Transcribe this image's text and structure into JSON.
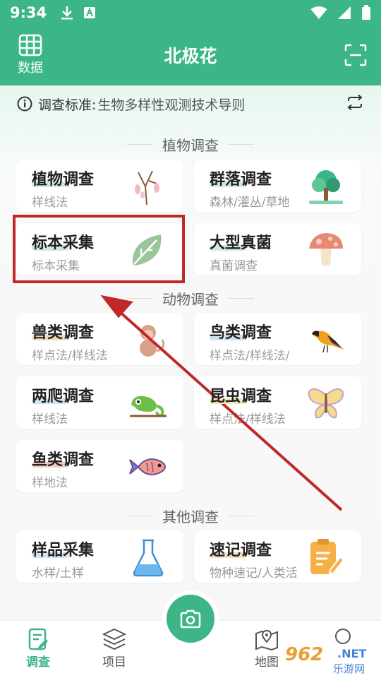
{
  "status_bar": {
    "time": "9:34"
  },
  "header": {
    "data_label": "数据",
    "title": "北极花"
  },
  "standard": {
    "label": "调查标准:",
    "value": "生物多样性观测技术导则"
  },
  "sections": {
    "plants": "植物调查",
    "animals": "动物调查",
    "other": "其他调查"
  },
  "cards": {
    "plant_survey": {
      "title": "植物调查",
      "subtitle": "样线法",
      "icon": "flower-branch-icon"
    },
    "community_survey": {
      "title": "群落调查",
      "subtitle": "森林/灌丛/草地",
      "icon": "tree-icon"
    },
    "specimen": {
      "title": "标本采集",
      "subtitle": "标本采集",
      "icon": "leaf-icon"
    },
    "fungi": {
      "title": "大型真菌",
      "subtitle": "真菌调查",
      "icon": "mushroom-icon"
    },
    "mammal": {
      "title": "兽类调查",
      "subtitle": "样点法/样线法",
      "icon": "monkey-icon"
    },
    "bird": {
      "title": "鸟类调查",
      "subtitle": "样点法/样线法/",
      "icon": "bird-icon"
    },
    "herp": {
      "title": "两爬调查",
      "subtitle": "样线法",
      "icon": "chameleon-icon"
    },
    "insect": {
      "title": "昆虫调查",
      "subtitle": "样点法/样线法",
      "icon": "butterfly-icon"
    },
    "fish": {
      "title": "鱼类调查",
      "subtitle": "样地法",
      "icon": "fish-icon"
    },
    "sample": {
      "title": "样品采集",
      "subtitle": "水样/土样",
      "icon": "flask-icon"
    },
    "quick": {
      "title": "速记调查",
      "subtitle": "物种速记/人类活",
      "icon": "notepad-icon"
    }
  },
  "bottom_nav": {
    "survey": "调查",
    "project": "项目",
    "map": "地图",
    "mine": ""
  },
  "watermark": {
    "num": "962",
    "net": ".NET",
    "cn": "乐游网"
  },
  "colors": {
    "brand": "#3cb587",
    "annotation": "#c0282a"
  }
}
